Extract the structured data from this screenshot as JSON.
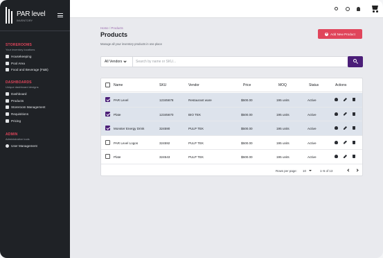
{
  "app": {
    "brand_title": "PAR level",
    "brand_sub": "INVENTORY"
  },
  "sidebar": {
    "sections": [
      {
        "title": "STOREROOMS",
        "subtitle": "Your inventory locations",
        "items": [
          {
            "label": "Housekeeping",
            "icon": "storeroom-icon"
          },
          {
            "label": "Pool Area",
            "icon": "storeroom-icon"
          },
          {
            "label": "Food and Beverage (F&B)",
            "icon": "storeroom-icon"
          }
        ]
      },
      {
        "title": "DASHBOARDS",
        "subtitle": "Unique dashboard designs",
        "items": [
          {
            "label": "Dashboard",
            "icon": "dashboard-icon"
          },
          {
            "label": "Products",
            "icon": "products-icon"
          },
          {
            "label": "Storeroom Management",
            "icon": "storeroom-management-icon"
          },
          {
            "label": "Requisitions",
            "icon": "requisitions-icon"
          },
          {
            "label": "Pricing",
            "icon": "pricing-icon"
          }
        ]
      },
      {
        "title": "ADMIN",
        "subtitle": "Administrative tools",
        "items": [
          {
            "label": "User Management",
            "icon": "user-icon"
          }
        ]
      }
    ]
  },
  "topbar": {
    "icons": [
      "search-icon",
      "gear-icon",
      "bell-icon",
      "cart-icon"
    ]
  },
  "page": {
    "breadcrumb_home": "Home",
    "breadcrumb_sep": "/",
    "breadcrumb_current": "Products",
    "title": "Products",
    "subtitle": "Manage all your inventory products in one place",
    "add_button": "Add New Product"
  },
  "search": {
    "vendor_select": "All Vendors",
    "placeholder": "Search by name or SKU..."
  },
  "table": {
    "columns": [
      "Name",
      "SKU",
      "Vendor",
      "Price",
      "MOQ",
      "Status",
      "Actions"
    ],
    "rows": [
      {
        "name": "PAR Level",
        "sku": "12345678",
        "vendor": "Restaurant ware",
        "price": "$500.00",
        "moq": "195 units",
        "status": "Active",
        "selected": true
      },
      {
        "name": "Plate",
        "sku": "12345670",
        "vendor": "BIO TEK",
        "price": "$500.00",
        "moq": "195 units",
        "status": "Active",
        "selected": true
      },
      {
        "name": "Monster Energy Drink",
        "sku": "324590",
        "vendor": "PULP TEK",
        "price": "$500.00",
        "moq": "195 units",
        "status": "Active",
        "selected": true
      },
      {
        "name": "PAR Level Logos",
        "sku": "324592",
        "vendor": "PULP TEK",
        "price": "$500.00",
        "moq": "195 units",
        "status": "Active",
        "selected": false
      },
      {
        "name": "Plate",
        "sku": "324543",
        "vendor": "PULP TEK",
        "price": "$500.00",
        "moq": "195 units",
        "status": "Active",
        "selected": false
      }
    ],
    "actions": [
      "view-icon",
      "edit-icon",
      "delete-icon"
    ]
  },
  "pagination": {
    "rows_per_page_label": "Rows per page:",
    "rows_per_page": "10",
    "range": "1–5 of 13"
  },
  "colors": {
    "accent": "#e0455b",
    "primary": "#4b1e78",
    "sidebar_bg": "#1f2226",
    "selected_row": "#dde3ec"
  }
}
